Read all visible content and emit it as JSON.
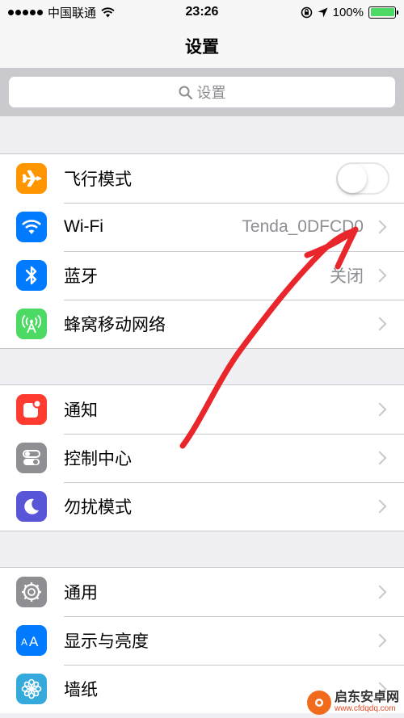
{
  "status_bar": {
    "carrier": "中国联通",
    "time": "23:26",
    "battery_percent": "100%",
    "battery_level": 1.0
  },
  "nav": {
    "title": "设置"
  },
  "search": {
    "placeholder": "设置"
  },
  "groups": [
    {
      "rows": [
        {
          "label": "飞行模式",
          "icon": "airplane-icon",
          "color": "#ff9500",
          "accessory": "toggle",
          "on": false
        },
        {
          "label": "Wi-Fi",
          "icon": "wifi-icon",
          "color": "#007aff",
          "value": "Tenda_0DFCD0",
          "accessory": "chevron"
        },
        {
          "label": "蓝牙",
          "icon": "bluetooth-icon",
          "color": "#007aff",
          "value": "关闭",
          "accessory": "chevron"
        },
        {
          "label": "蜂窝移动网络",
          "icon": "cellular-icon",
          "color": "#4cd964",
          "accessory": "chevron"
        }
      ]
    },
    {
      "rows": [
        {
          "label": "通知",
          "icon": "notifications-icon",
          "color": "#ff3b30",
          "accessory": "chevron"
        },
        {
          "label": "控制中心",
          "icon": "control-center-icon",
          "color": "#8e8e93",
          "accessory": "chevron"
        },
        {
          "label": "勿扰模式",
          "icon": "moon-icon",
          "color": "#5856d6",
          "accessory": "chevron"
        }
      ]
    },
    {
      "rows": [
        {
          "label": "通用",
          "icon": "gear-icon",
          "color": "#8e8e93",
          "accessory": "chevron"
        },
        {
          "label": "显示与亮度",
          "icon": "display-icon",
          "color": "#007aff",
          "accessory": "chevron"
        },
        {
          "label": "墙纸",
          "icon": "wallpaper-icon",
          "color": "#34aadc",
          "accessory": "chevron"
        }
      ]
    }
  ],
  "watermark": {
    "name": "启东安卓网",
    "url": "www.cfdqdq.com"
  },
  "colors": {
    "accent": "#007aff",
    "annotation": "#e8262b"
  }
}
